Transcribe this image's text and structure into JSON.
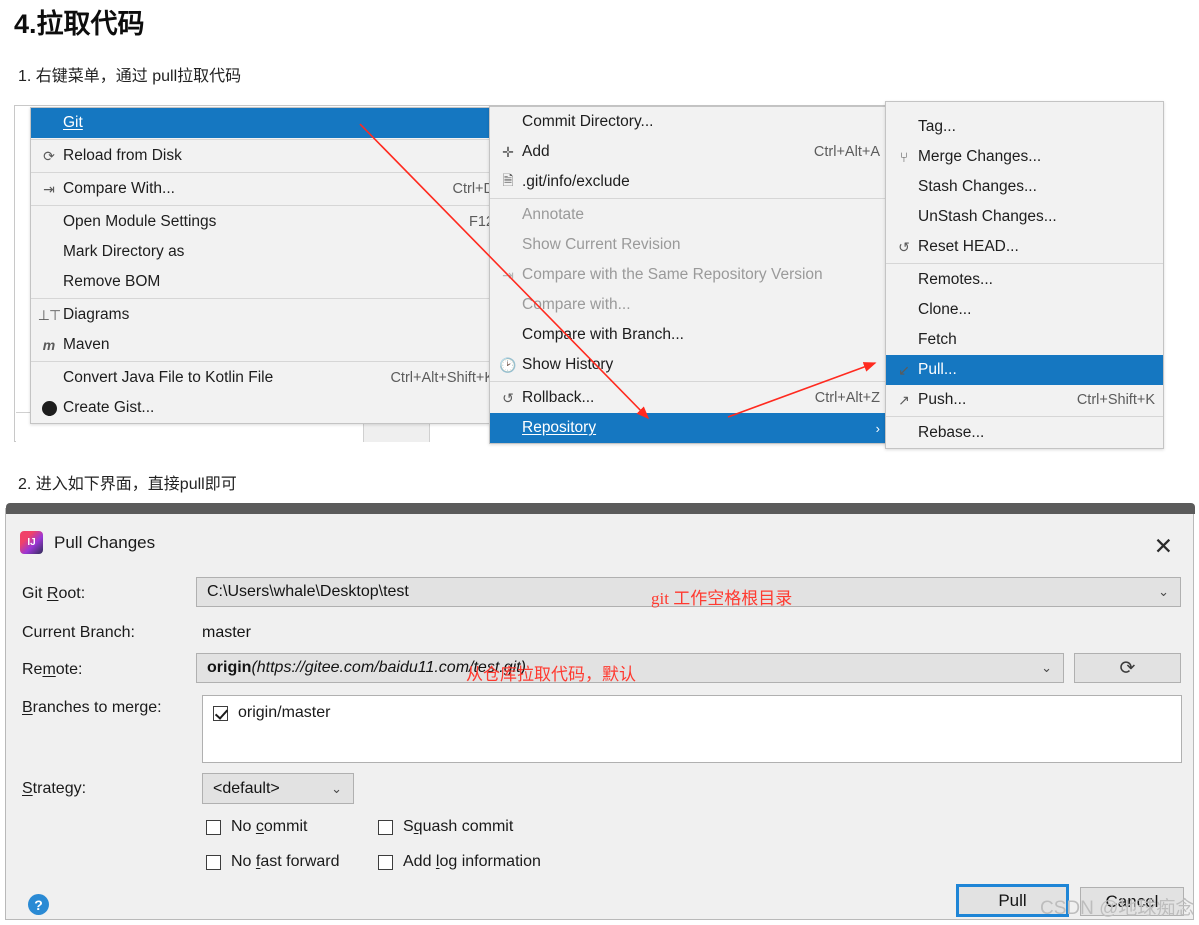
{
  "page": {
    "title": "4.拉取代码",
    "step1": "1. 右键菜单，通过 pull拉取代码",
    "step2": "2. 进入如下界面，直接pull即可"
  },
  "context_menu": {
    "left_items": [
      {
        "label": "Git",
        "accel": "",
        "arrow": "›",
        "selected": true,
        "disabled": false,
        "icon": "",
        "underline": "G"
      },
      {
        "label": "Reload from Disk",
        "accel": "",
        "arrow": "",
        "selected": false,
        "disabled": false,
        "icon": "refresh-icon"
      },
      {
        "label": "Compare With...",
        "accel": "Ctrl+D",
        "arrow": "",
        "selected": false,
        "disabled": false,
        "icon": "compare-icon"
      },
      {
        "label": "Open Module Settings",
        "accel": "F12",
        "arrow": "",
        "selected": false,
        "disabled": false,
        "icon": ""
      },
      {
        "label": "Mark Directory as",
        "accel": "",
        "arrow": "›",
        "selected": false,
        "disabled": false,
        "icon": ""
      },
      {
        "label": "Remove BOM",
        "accel": "",
        "arrow": "",
        "selected": false,
        "disabled": false,
        "icon": ""
      },
      {
        "label": "Diagrams",
        "accel": "",
        "arrow": "›",
        "selected": false,
        "disabled": false,
        "icon": "diagram-icon"
      },
      {
        "label": "Maven",
        "accel": "",
        "arrow": "›",
        "selected": false,
        "disabled": false,
        "icon": "maven-icon"
      },
      {
        "label": "Convert Java File to Kotlin File",
        "accel": "Ctrl+Alt+Shift+K",
        "arrow": "",
        "selected": false,
        "disabled": false,
        "icon": ""
      },
      {
        "label": "Create Gist...",
        "accel": "",
        "arrow": "",
        "selected": false,
        "disabled": false,
        "icon": "github-icon"
      }
    ],
    "mid_items": [
      {
        "label": "Commit Directory...",
        "accel": "",
        "arrow": "",
        "selected": false,
        "disabled": false,
        "icon": ""
      },
      {
        "label": "Add",
        "accel": "Ctrl+Alt+A",
        "arrow": "",
        "selected": false,
        "disabled": false,
        "icon": "plus-icon"
      },
      {
        "label": ".git/info/exclude",
        "accel": "",
        "arrow": "",
        "selected": false,
        "disabled": false,
        "icon": "exclude-file-icon"
      },
      {
        "label": "Annotate",
        "accel": "",
        "arrow": "",
        "selected": false,
        "disabled": true,
        "icon": ""
      },
      {
        "label": "Show Current Revision",
        "accel": "",
        "arrow": "",
        "selected": false,
        "disabled": true,
        "icon": ""
      },
      {
        "label": "Compare with the Same Repository Version",
        "accel": "",
        "arrow": "",
        "selected": false,
        "disabled": true,
        "icon": "compare-icon"
      },
      {
        "label": "Compare with...",
        "accel": "",
        "arrow": "",
        "selected": false,
        "disabled": true,
        "icon": ""
      },
      {
        "label": "Compare with Branch...",
        "accel": "",
        "arrow": "",
        "selected": false,
        "disabled": false,
        "icon": ""
      },
      {
        "label": "Show History",
        "accel": "",
        "arrow": "",
        "selected": false,
        "disabled": false,
        "icon": "clock-icon"
      },
      {
        "label": "Rollback...",
        "accel": "Ctrl+Alt+Z",
        "arrow": "",
        "selected": false,
        "disabled": false,
        "icon": "rollback-icon"
      },
      {
        "label": "Repository",
        "accel": "",
        "arrow": "›",
        "selected": true,
        "disabled": false,
        "icon": ""
      }
    ],
    "right_items": [
      {
        "label": "Tag...",
        "accel": "",
        "selected": false,
        "icon": ""
      },
      {
        "label": "Merge Changes...",
        "accel": "",
        "selected": false,
        "icon": "merge-icon"
      },
      {
        "label": "Stash Changes...",
        "accel": "",
        "selected": false,
        "icon": ""
      },
      {
        "label": "UnStash Changes...",
        "accel": "",
        "selected": false,
        "icon": ""
      },
      {
        "label": "Reset HEAD...",
        "accel": "",
        "selected": false,
        "icon": "reset-icon"
      },
      {
        "label": "Remotes...",
        "accel": "",
        "selected": false,
        "icon": ""
      },
      {
        "label": "Clone...",
        "accel": "",
        "selected": false,
        "icon": ""
      },
      {
        "label": "Fetch",
        "accel": "",
        "selected": false,
        "icon": ""
      },
      {
        "label": "Pull...",
        "accel": "",
        "selected": true,
        "icon": "pull-arrow-icon"
      },
      {
        "label": "Push...",
        "accel": "Ctrl+Shift+K",
        "selected": false,
        "icon": "push-arrow-icon"
      },
      {
        "label": "Rebase...",
        "accel": "",
        "selected": false,
        "icon": ""
      }
    ]
  },
  "dialog": {
    "title": "Pull Changes",
    "close_label": "✕",
    "app_icon": "intellij-idea-icon",
    "labels": {
      "git_root": "Git Root:",
      "current_branch": "Current Branch:",
      "remote": "Remote:",
      "branches_to_merge": "Branches to merge:",
      "strategy": "Strategy:"
    },
    "values": {
      "git_root": "C:\\Users\\whale\\Desktop\\test",
      "current_branch": "master",
      "remote_name": "origin",
      "remote_url": "(https://gitee.com/baidu11.com/test.git)",
      "branch_item": "origin/master",
      "branch_item_checked": true,
      "strategy": "<default>"
    },
    "annotations": {
      "git_root_note": "git 工作空格根目录",
      "remote_note": "从仓库拉取代码，默认"
    },
    "checkboxes": [
      {
        "label": "No commit",
        "checked": false
      },
      {
        "label": "Squash commit",
        "checked": false
      },
      {
        "label": "No fast forward",
        "checked": false
      },
      {
        "label": "Add log information",
        "checked": false
      }
    ],
    "buttons": {
      "pull": "Pull",
      "cancel": "Cancel",
      "help": "?",
      "refresh": "⟳"
    },
    "watermark": "CSDN @地球痴念"
  },
  "colors": {
    "accent_blue": "#1577c1",
    "annotation_red": "#ff3a30",
    "primary_border": "#1e85d6"
  }
}
